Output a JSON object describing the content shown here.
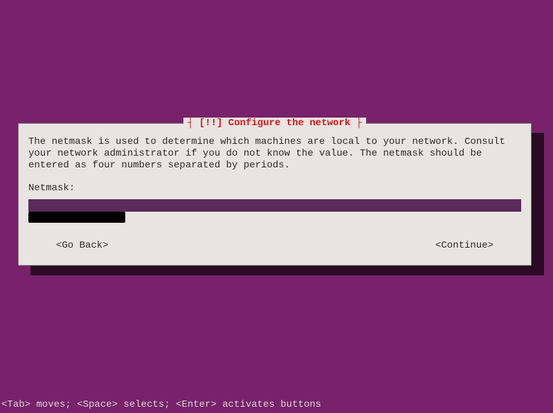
{
  "dialog": {
    "title_prefix": "[!!]",
    "title": "Configure the network",
    "description": "The netmask is used to determine which machines are local to your network.  Consult your network administrator if you do not know the value.  The netmask should be entered as four numbers separated by periods.",
    "field_label": "Netmask:",
    "input_value": "",
    "go_back_label": "<Go Back>",
    "continue_label": "<Continue>"
  },
  "footer": {
    "help_text": "<Tab> moves; <Space> selects; <Enter> activates buttons"
  }
}
